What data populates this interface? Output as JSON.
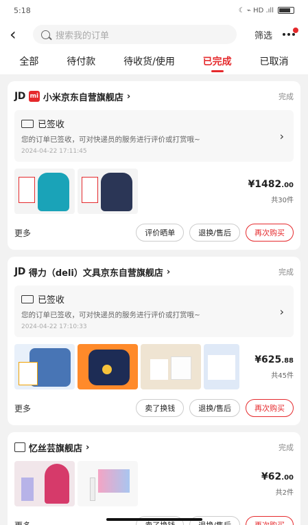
{
  "status_bar": {
    "time": "5:18",
    "icons": "☾ ⌁ HD .ıll"
  },
  "header": {
    "search_placeholder": "搜索我的订单",
    "filter_label": "筛选"
  },
  "tabs": [
    {
      "label": "全部"
    },
    {
      "label": "待付款"
    },
    {
      "label": "待收货/使用"
    },
    {
      "label": "已完成"
    },
    {
      "label": "已取消"
    }
  ],
  "active_tab": "已完成",
  "orders": [
    {
      "shop": "小米京东自营旗舰店",
      "status": "完成",
      "track_title": "已签收",
      "track_desc": "您的订单已签收，可对快递员的服务进行评价或打赏哦~",
      "track_time": "2024-04-22 17:11:45",
      "price_int": "¥1482",
      "price_dec": ".00",
      "count": "共30件",
      "buttons": [
        "评价晒单",
        "退换/售后",
        "再次购买"
      ],
      "more": "更多"
    },
    {
      "shop": "得力（deli）文具京东自营旗舰店",
      "status": "完成",
      "track_title": "已签收",
      "track_desc": "您的订单已签收，可对快递员的服务进行评价或打赏哦~",
      "track_time": "2024-04-22 17:10:33",
      "price_int": "¥625",
      "price_dec": ".88",
      "count": "共45件",
      "buttons": [
        "卖了换钱",
        "退换/售后",
        "再次购买"
      ],
      "more": "更多"
    },
    {
      "shop": "忆丝芸旗舰店",
      "status": "完成",
      "price_int": "¥62",
      "price_dec": ".00",
      "count": "共2件",
      "buttons": [
        "卖了换钱",
        "退换/售后",
        "再次购买"
      ],
      "more": "更多"
    }
  ],
  "colors": {
    "accent": "#e5292c",
    "background": "#f2f2f2"
  }
}
